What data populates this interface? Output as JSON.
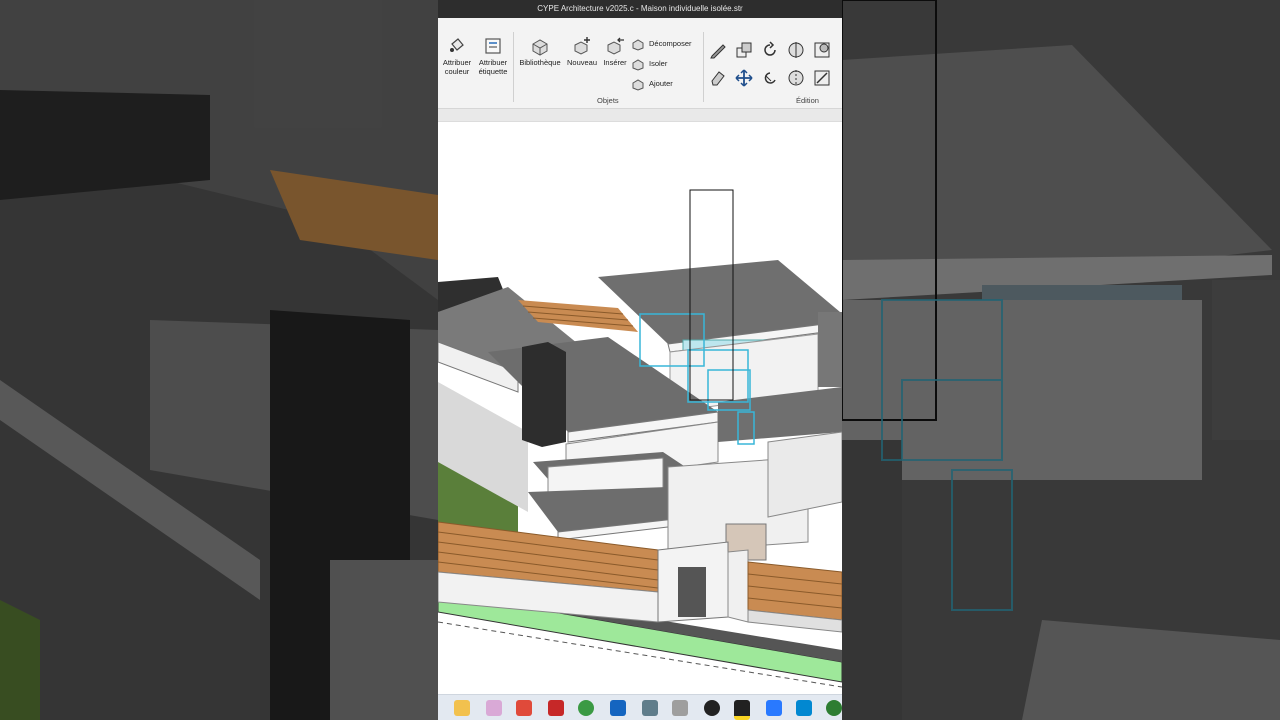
{
  "window": {
    "title": "CYPE Architecture v2025.c - Maison individuelle isolée.str"
  },
  "ribbon": {
    "attribuer_couleur": "Attribuer\ncouleur",
    "attribuer_couleur_l1": "Attribuer",
    "attribuer_couleur_l2": "couleur",
    "attribuer_etiquette_l1": "Attribuer",
    "attribuer_etiquette_l2": "étiquette",
    "bibliotheque": "Bibliothèque",
    "nouveau": "Nouveau",
    "inserer": "Insérer",
    "decomposer": "Décomposer",
    "isoler": "Isoler",
    "ajouter": "Ajouter",
    "group_objets": "Objets",
    "group_edition": "Édition"
  },
  "colors": {
    "titlebar": "#2d2d2d",
    "ribbon": "#f3f3f3",
    "roof": "#6f6f6f",
    "wall": "#f2f2f2",
    "fence": "#c98b52",
    "stone": "#3a3a3a",
    "grass": "#5a7f3a",
    "lawn_strip": "#9ee89a",
    "selection": "#38b6d8",
    "taskbar": "#e3e9f1"
  },
  "taskbar": {
    "icons": [
      "file-explorer-icon",
      "snipping-icon",
      "paint-icon",
      "pdf-icon",
      "chrome-icon",
      "outlook-icon",
      "camera-icon",
      "usb-icon",
      "record-icon",
      "sticky-notes-icon",
      "calendar-icon",
      "remote-desktop-icon",
      "whatsapp-icon"
    ]
  }
}
